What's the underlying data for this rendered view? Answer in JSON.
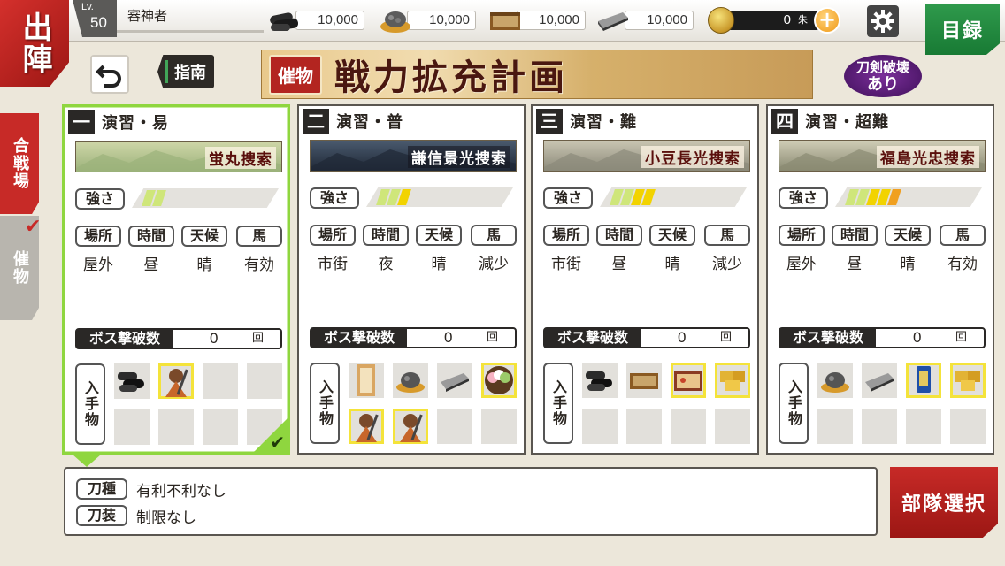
{
  "header": {
    "sortie_label": "出陣",
    "level_label": "Lv.",
    "level": "50",
    "player_name": "審神者",
    "resources": [
      {
        "name": "charcoal",
        "icon": "charcoal-icon",
        "value": "10,000"
      },
      {
        "name": "tamahagane",
        "icon": "tamahagane-icon",
        "value": "10,000"
      },
      {
        "name": "coolant",
        "icon": "coolant-icon",
        "value": "10,000"
      },
      {
        "name": "whetstone",
        "icon": "whetstone-icon",
        "value": "10,000"
      }
    ],
    "koban_value": "0",
    "koban_unit": "朱",
    "plus_label": "+",
    "catalog_label": "目録"
  },
  "toolbar": {
    "guide_label": "指南",
    "event_tag": "催物",
    "event_title": "戦力拡充計画",
    "break_badge_line1": "刀剣破壊",
    "break_badge_line2": "あり"
  },
  "side_tabs": [
    {
      "label": "合戦場",
      "active": true
    },
    {
      "label": "催物",
      "active": false
    }
  ],
  "labels": {
    "strength": "強さ",
    "place": "場所",
    "time": "時間",
    "weather": "天候",
    "horse": "馬",
    "boss_kills": "ボス撃破数",
    "boss_unit": "回",
    "loot": "入手物"
  },
  "stages": [
    {
      "number": "一",
      "title": "演習・易",
      "mission": "蛍丸捜索",
      "strength_level": 2,
      "conditions": {
        "place": "屋外",
        "time": "昼",
        "weather": "晴",
        "horse": "有効"
      },
      "boss_kills": "0",
      "selected": true,
      "banner_colors": [
        "#9bb27a",
        "#cfd6a8"
      ],
      "loot": [
        {
          "icon": "charcoal-icon",
          "rare": false
        },
        {
          "icon": "sword-boy-icon",
          "rare": true
        },
        {
          "icon": "",
          "rare": false
        },
        {
          "icon": "",
          "rare": false
        },
        {
          "icon": "",
          "rare": false
        },
        {
          "icon": "",
          "rare": false
        },
        {
          "icon": "",
          "rare": false
        },
        {
          "icon": "",
          "rare": false
        }
      ]
    },
    {
      "number": "二",
      "title": "演習・普",
      "mission": "謙信景光捜索",
      "strength_level": 3,
      "conditions": {
        "place": "市街",
        "time": "夜",
        "weather": "晴",
        "horse": "減少"
      },
      "boss_kills": "0",
      "selected": false,
      "banner_colors": [
        "#1f2836",
        "#4a5a6e"
      ],
      "loot": [
        {
          "icon": "guide-scroll-icon",
          "rare": false
        },
        {
          "icon": "tamahagane-icon",
          "rare": false
        },
        {
          "icon": "whetstone-icon",
          "rare": false
        },
        {
          "icon": "dango-icon",
          "rare": true
        },
        {
          "icon": "sword-boy-icon",
          "rare": true
        },
        {
          "icon": "sword-boy-icon",
          "rare": true
        },
        {
          "icon": "",
          "rare": false
        },
        {
          "icon": "",
          "rare": false
        }
      ]
    },
    {
      "number": "三",
      "title": "演習・難",
      "mission": "小豆長光捜索",
      "strength_level": 4,
      "conditions": {
        "place": "市街",
        "time": "昼",
        "weather": "晴",
        "horse": "減少"
      },
      "boss_kills": "0",
      "selected": false,
      "banner_colors": [
        "#8c8a7a",
        "#c9c5b2"
      ],
      "loot": [
        {
          "icon": "charcoal-icon",
          "rare": false
        },
        {
          "icon": "coolant-icon",
          "rare": false
        },
        {
          "icon": "bento-icon",
          "rare": true
        },
        {
          "icon": "koban-icon",
          "rare": true
        },
        {
          "icon": "",
          "rare": false
        },
        {
          "icon": "",
          "rare": false
        },
        {
          "icon": "",
          "rare": false
        },
        {
          "icon": "",
          "rare": false
        }
      ]
    },
    {
      "number": "四",
      "title": "演習・超難",
      "mission": "福島光忠捜索",
      "strength_level": 5,
      "conditions": {
        "place": "屋外",
        "time": "昼",
        "weather": "晴",
        "horse": "有効"
      },
      "boss_kills": "0",
      "selected": false,
      "banner_colors": [
        "#8a8a72",
        "#cfcdb6"
      ],
      "loot": [
        {
          "icon": "tamahagane-icon",
          "rare": false
        },
        {
          "icon": "whetstone-icon",
          "rare": false
        },
        {
          "icon": "amulet-icon",
          "rare": true
        },
        {
          "icon": "koban-icon",
          "rare": true
        },
        {
          "icon": "",
          "rare": false
        },
        {
          "icon": "",
          "rare": false
        },
        {
          "icon": "",
          "rare": false
        },
        {
          "icon": "",
          "rare": false
        }
      ]
    }
  ],
  "restrictions": {
    "sword_type_label": "刀種",
    "sword_type_value": "有利不利なし",
    "equipment_label": "刀装",
    "equipment_value": "制限なし"
  },
  "party_select_label": "部隊選択",
  "colors": {
    "accent_red": "#c72a27",
    "selected_green": "#8fd63f",
    "strength_yellow": "#f2d300",
    "strength_orange": "#f0a020",
    "strength_light": "#cfe67a"
  }
}
